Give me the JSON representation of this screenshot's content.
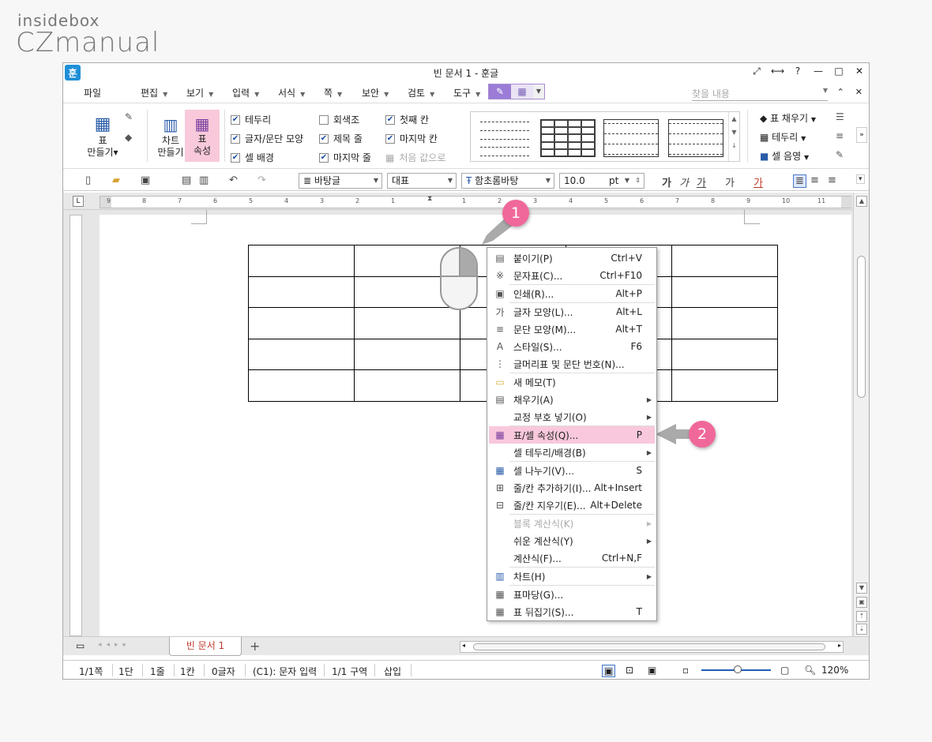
{
  "brand": {
    "line1": "insidebox",
    "line2": "CZmanual"
  },
  "window": {
    "title": "빈 문서 1 - 훈글",
    "app_icon": "훈"
  },
  "menu": {
    "file": "파일",
    "items": [
      "편집",
      "보기",
      "입력",
      "서식",
      "쪽",
      "보안",
      "검토",
      "도구"
    ],
    "help_placeholder": "찾을 내용"
  },
  "ribbon": {
    "table_make": [
      "표",
      "만들기"
    ],
    "chart_make": [
      "차트",
      "만들기"
    ],
    "table_props": [
      "표",
      "속성"
    ],
    "checks": [
      {
        "label": "테두리",
        "checked": true
      },
      {
        "label": "글자/문단 모양",
        "checked": true
      },
      {
        "label": "셀 배경",
        "checked": true
      },
      {
        "label": "회색조",
        "checked": false
      },
      {
        "label": "제목 줄",
        "checked": true
      },
      {
        "label": "마지막 줄",
        "checked": true
      },
      {
        "label": "첫째 칸",
        "checked": true
      },
      {
        "label": "마지막 칸",
        "checked": true
      }
    ],
    "reset_label": "처음 값으로",
    "fill_label": "표 채우기",
    "border_label": "테두리",
    "shade_label": "셀 음영"
  },
  "toolbar": {
    "style": "바탕글",
    "lang": "대표",
    "font": "함초롬바탕",
    "size": "10.0",
    "unit": "pt"
  },
  "ruler": {
    "ticks": [
      "9",
      "8",
      "7",
      "6",
      "5",
      "4",
      "3",
      "2",
      "1",
      "1",
      "2",
      "3",
      "4",
      "5",
      "6",
      "7",
      "8",
      "9",
      "10",
      "11"
    ]
  },
  "context_menu": [
    {
      "icon": "paste-icon",
      "glyph": "▤",
      "label": "붙이기(P)",
      "shortcut": "Ctrl+V"
    },
    {
      "icon": "symbol-icon",
      "glyph": "※",
      "label": "문자표(C)...",
      "shortcut": "Ctrl+F10"
    },
    {
      "icon": "print-icon",
      "glyph": "▣",
      "label": "인쇄(R)...",
      "shortcut": "Alt+P"
    },
    {
      "icon": "char-shape-icon",
      "glyph": "가",
      "label": "글자 모양(L)...",
      "shortcut": "Alt+L"
    },
    {
      "icon": "para-shape-icon",
      "glyph": "≡",
      "label": "문단 모양(M)...",
      "shortcut": "Alt+T"
    },
    {
      "icon": "style-icon",
      "glyph": "A",
      "label": "스타일(S)...",
      "shortcut": "F6"
    },
    {
      "icon": "bullet-icon",
      "glyph": "⋮",
      "label": "글머리표 및 문단 번호(N)...",
      "shortcut": ""
    },
    {
      "icon": "memo-icon",
      "glyph": "▭",
      "label": "새 메모(T)",
      "shortcut": ""
    },
    {
      "icon": "fill-icon",
      "glyph": "▤",
      "label": "채우기(A)",
      "shortcut": "",
      "sub": true
    },
    {
      "icon": "",
      "glyph": "",
      "label": "교정 부호 넣기(O)",
      "shortcut": "",
      "sub": true
    },
    {
      "icon": "table-props-icon",
      "glyph": "▦",
      "label": "표/셀 속성(Q)...",
      "shortcut": "P",
      "highlight": true
    },
    {
      "icon": "",
      "glyph": "",
      "label": "셀 테두리/배경(B)",
      "shortcut": "",
      "sub": true
    },
    {
      "icon": "split-cell-icon",
      "glyph": "▦",
      "label": "셀 나누기(V)...",
      "shortcut": "S"
    },
    {
      "icon": "add-row-icon",
      "glyph": "⊞",
      "label": "줄/칸 추가하기(I)...",
      "shortcut": "Alt+Insert"
    },
    {
      "icon": "delete-row-icon",
      "glyph": "⊟",
      "label": "줄/칸 지우기(E)...",
      "shortcut": "Alt+Delete"
    },
    {
      "icon": "",
      "glyph": "",
      "label": "블록 계산식(K)",
      "shortcut": "",
      "sub": true,
      "disabled": true
    },
    {
      "icon": "",
      "glyph": "",
      "label": "쉬운 계산식(Y)",
      "shortcut": "",
      "sub": true
    },
    {
      "icon": "",
      "glyph": "",
      "label": "계산식(F)...",
      "shortcut": "Ctrl+N,F"
    },
    {
      "icon": "chart-icon",
      "glyph": "▥",
      "label": "차트(H)",
      "shortcut": "",
      "sub": true
    },
    {
      "icon": "table-style-icon",
      "glyph": "▦",
      "label": "표마당(G)...",
      "shortcut": ""
    },
    {
      "icon": "transpose-icon",
      "glyph": "▦",
      "label": "표 뒤집기(S)...",
      "shortcut": "T"
    }
  ],
  "badges": [
    "1",
    "2"
  ],
  "tab": {
    "name": "빈 문서 1",
    "add": "+"
  },
  "status": {
    "page": "1/1쪽",
    "col": "1단",
    "line": "1줄",
    "cell": "1칸",
    "chars": "0글자",
    "mode": "(C1): 문자 입력",
    "section": "1/1 구역",
    "insert": "삽입",
    "zoom": "120%"
  }
}
